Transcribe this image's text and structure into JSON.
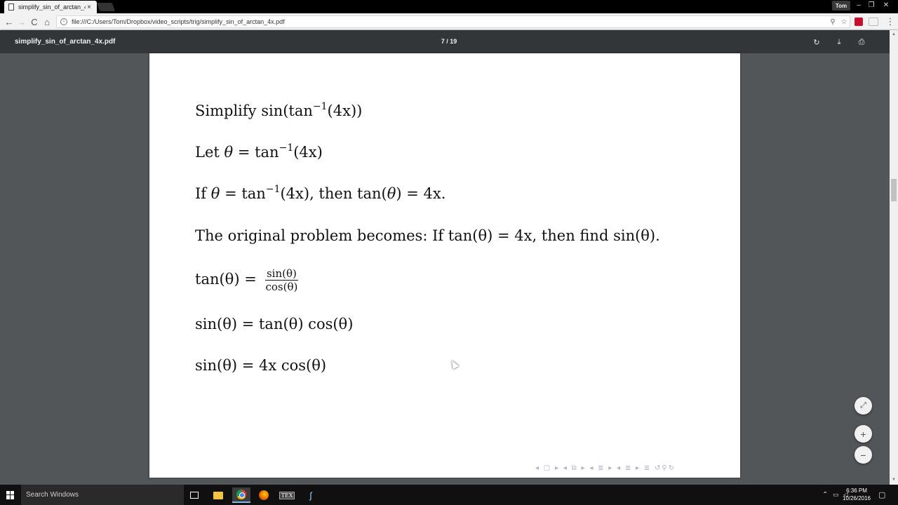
{
  "browser": {
    "tab_title": "simplify_sin_of_arctan_4x",
    "tab_close": "×",
    "user_name": "Tom",
    "window_controls": {
      "minimize": "–",
      "maximize": "❐",
      "close": "✕"
    },
    "url": "file:///C:/Users/Tom/Dropbox/video_scripts/trig/simplify_sin_of_arctan_4x.pdf",
    "nav": {
      "back": "←",
      "forward": "→",
      "reload": "C",
      "home": "⌂",
      "menu": "⋮"
    },
    "omni_icons": {
      "info": "i",
      "zoom": "⚲",
      "star": "☆"
    }
  },
  "pdf_viewer": {
    "file_name": "simplify_sin_of_arctan_4x.pdf",
    "page_indicator": "7  /  19",
    "tools": {
      "rotate": "↻",
      "download": "⤓",
      "print": "⎙"
    },
    "zoom_controls": {
      "fit": "⤢",
      "zoom_in": "+",
      "zoom_out": "−"
    }
  },
  "slide": {
    "lines": [
      {
        "text": "Simplify sin(tan",
        "sup": "−1",
        "after": "(4x))"
      },
      {
        "pre": "Let ",
        "var": "θ",
        "text": " = tan",
        "sup": "−1",
        "after": "(4x)"
      },
      {
        "pre": "If ",
        "var": "θ",
        "text": " = tan",
        "sup": "−1",
        "after": "(4x), then tan(",
        "var2": "θ",
        "after2": ") = 4x."
      },
      {
        "full": "The original problem becomes: If tan(θ) = 4x, then find sin(θ)."
      },
      {
        "lhs": "tan(θ) = ",
        "num": "sin(θ)",
        "den": "cos(θ)"
      },
      {
        "full": "sin(θ) = tan(θ)  cos(θ)"
      },
      {
        "full": "sin(θ) = 4x  cos(θ)"
      }
    ],
    "nav_symbols": "◂ ▢ ▸ ◂ ⧉ ▸ ◂ ≣ ▸ ◂ ≣ ▸  ≣  ↺⚲↻"
  },
  "taskbar": {
    "search_placeholder": "Search Windows",
    "tex_label": "TEX",
    "other_app": "ʃ",
    "clock_time": "6:36 PM",
    "clock_date": "10/26/2016",
    "tray_icons": {
      "chevron": "⌃",
      "network": "🖥",
      "volume": "🔊",
      "notifications": "🗨"
    }
  }
}
